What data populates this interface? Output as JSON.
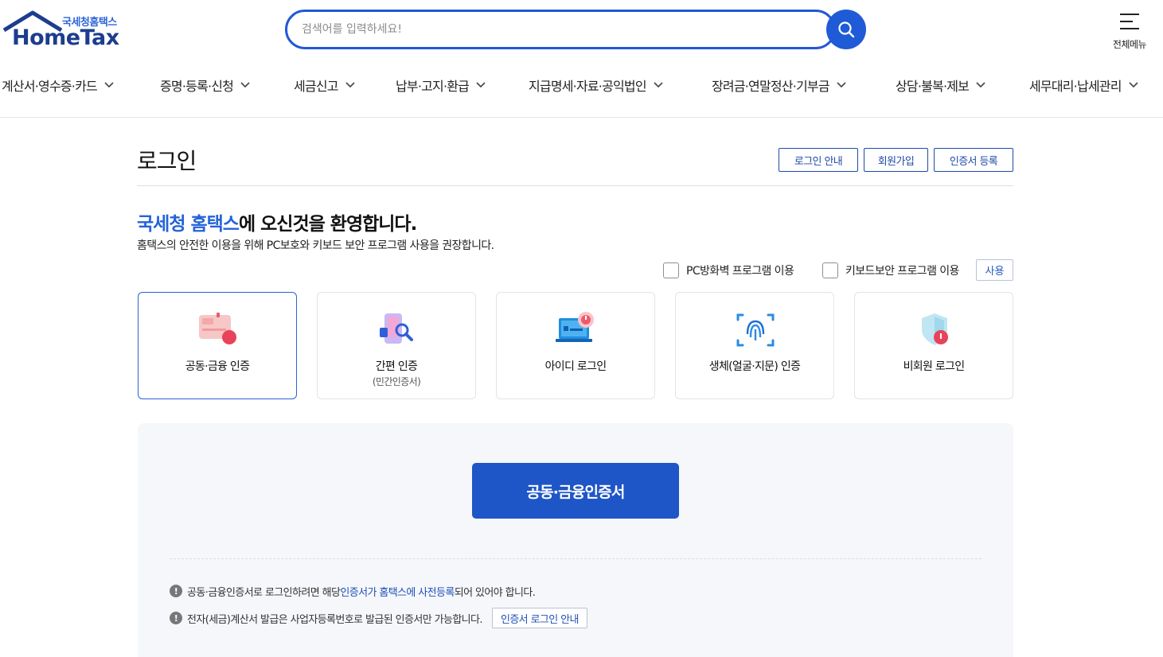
{
  "header": {
    "logo_sub": "국세청홈택스",
    "logo_main": "HomeTax",
    "search_placeholder": "검색어를 입력하세요!",
    "all_menu_label": "전체메뉴"
  },
  "gnb": [
    {
      "label": "계산서·영수증·카드"
    },
    {
      "label": "증명·등록·신청"
    },
    {
      "label": "세금신고"
    },
    {
      "label": "납부·고지·환급"
    },
    {
      "label": "지급명세·자료·공익법인"
    },
    {
      "label": "장려금·연말정산·기부금"
    },
    {
      "label": "상담·불복·제보"
    },
    {
      "label": "세무대리·납세관리"
    }
  ],
  "page": {
    "title": "로그인",
    "buttons": {
      "login_guide": "로그인 안내",
      "signup": "회원가입",
      "cert_register": "인증서 등록"
    },
    "welcome_highlight": "국세청 홈택스",
    "welcome_rest": "에 오신것을 환영합니다.",
    "welcome_sub": "홈택스의 안전한 이용을 위해 PC보호와 키보드 보안 프로그램 사용을 권장합니다.",
    "checkboxes": {
      "firewall": "PC방화벽 프로그램 이용",
      "keyboard": "키보드보안 프로그램 이용"
    },
    "use_button": "사용"
  },
  "login_methods": [
    {
      "label": "공동·금융 인증",
      "sub": "",
      "icon": "certificate-icon",
      "active": true
    },
    {
      "label": "간편 인증",
      "sub": "(민간인증서)",
      "icon": "simple-auth-icon",
      "active": false
    },
    {
      "label": "아이디 로그인",
      "sub": "",
      "icon": "id-login-icon",
      "active": false
    },
    {
      "label": "생체(얼굴·지문) 인증",
      "sub": "",
      "icon": "fingerprint-icon",
      "active": false
    },
    {
      "label": "비회원 로그인",
      "sub": "",
      "icon": "guest-shield-icon",
      "active": false
    }
  ],
  "cert_panel": {
    "button": "공동·금융인증서",
    "note1_before": "공동·금융인증서로 로그인하려면 해당 ",
    "note1_link": "인증서가 홈택스에 사전등록",
    "note1_after": "되어 있어야 합니다.",
    "note2": "전자(세금)계산서 발급은 사업자등록번호로 발급된 인증서만 가능합니다.",
    "note2_button": "인증서 로그인 안내"
  },
  "colors": {
    "brand_blue": "#1e56c8",
    "highlight_blue": "#2462d8",
    "logo_navy": "#1c3d8f"
  }
}
